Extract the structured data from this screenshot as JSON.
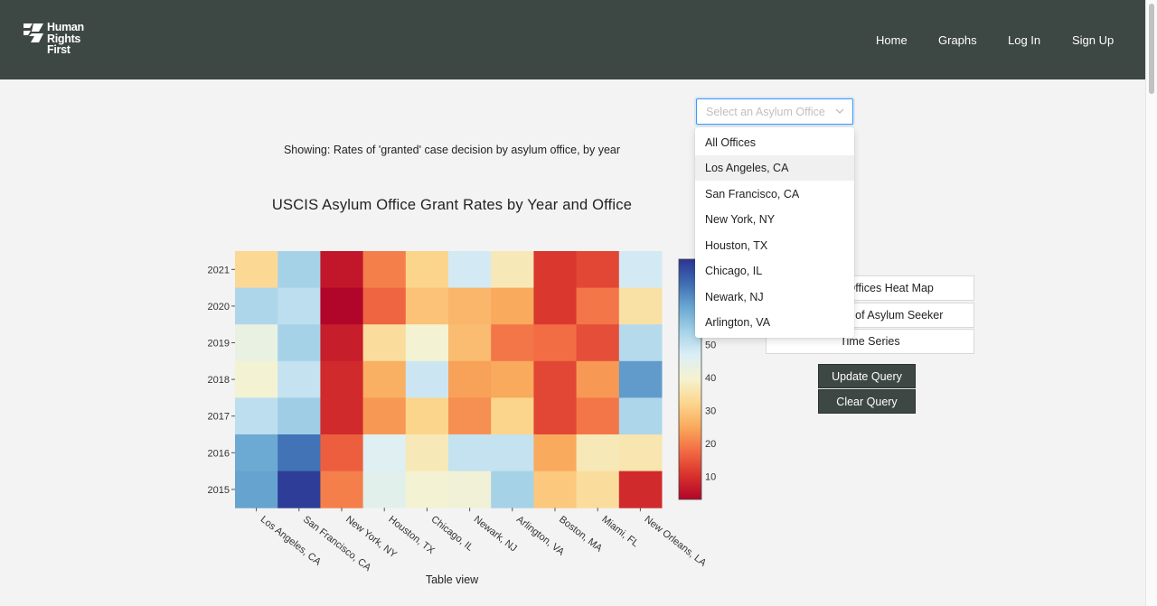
{
  "header": {
    "logo_lines": [
      "Human",
      "Rights",
      "First"
    ],
    "nav": [
      "Home",
      "Graphs",
      "Log In",
      "Sign Up"
    ]
  },
  "showing_text": "Showing: Rates of 'granted' case decision by asylum office, by year",
  "table_view_label": "Table view",
  "select": {
    "placeholder": "Select an Asylum Office",
    "options": [
      "All Offices",
      "Los Angeles, CA",
      "San Francisco, CA",
      "New York, NY",
      "Houston, TX",
      "Chicago, IL",
      "Newark, NJ",
      "Arlington, VA"
    ],
    "highlighted_index": 1
  },
  "side_buttons": [
    "Asylum Offices Heat Map",
    "Citizenship of Asylum Seeker",
    "Time Series"
  ],
  "action_buttons": {
    "update": "Update Query",
    "clear": "Clear Query"
  },
  "chart_data": {
    "type": "heatmap",
    "title": "USCIS Asylum Office Grant Rates by Year and Office",
    "x": [
      "Los Angeles, CA",
      "San Francisco, CA",
      "New York, NY",
      "Houston, TX",
      "Chicago, IL",
      "Newark, NJ",
      "Arlington, VA",
      "Boston, MA",
      "Miami, FL",
      "New Orleans, LA"
    ],
    "y": [
      "2021",
      "2020",
      "2019",
      "2018",
      "2017",
      "2016",
      "2015"
    ],
    "z": [
      [
        33,
        54,
        6,
        20,
        32,
        48,
        37,
        11,
        13,
        48
      ],
      [
        53,
        51,
        3,
        17,
        29,
        27,
        25,
        11,
        19,
        35
      ],
      [
        43,
        54,
        7,
        34,
        40,
        28,
        19,
        18,
        14,
        52
      ],
      [
        40,
        50,
        9,
        26,
        49,
        24,
        25,
        13,
        23,
        63
      ],
      [
        51,
        55,
        9,
        23,
        32,
        22,
        32,
        13,
        19,
        53
      ],
      [
        61,
        68,
        16,
        46,
        37,
        50,
        50,
        25,
        37,
        36
      ],
      [
        62,
        75,
        20,
        45,
        40,
        41,
        54,
        30,
        34,
        9
      ]
    ],
    "colorbar_ticks": [
      10,
      20,
      30,
      40,
      50
    ],
    "zmin": 3,
    "zmax": 76,
    "colorscale": [
      "#b2052a",
      "#d8322c",
      "#f26a43",
      "#f9a95c",
      "#fcd68d",
      "#f5f2cf",
      "#dceff6",
      "#a5d2e8",
      "#6aa8d2",
      "#3e6db3",
      "#2c3592"
    ]
  }
}
